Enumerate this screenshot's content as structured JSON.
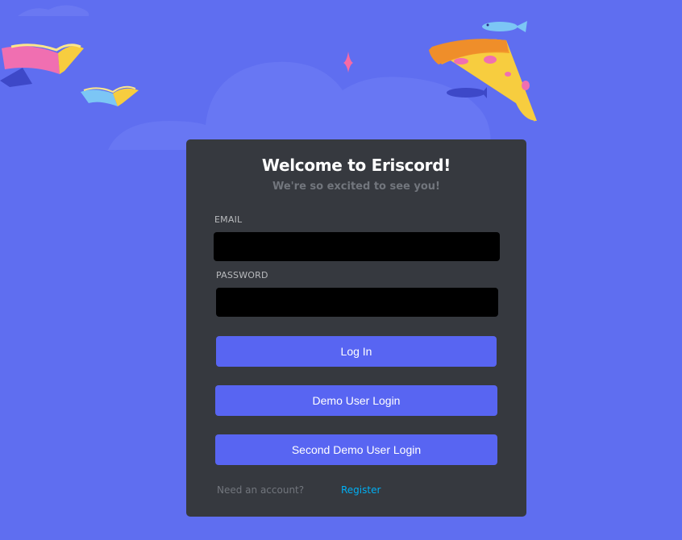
{
  "login": {
    "title": "Welcome to Eriscord!",
    "subtitle": "We're so excited to see you!",
    "email_label": "EMAIL",
    "email_value": "",
    "password_label": "PASSWORD",
    "password_value": "",
    "login_button": "Log In",
    "demo_button": "Demo User Login",
    "second_demo_button": "Second Demo User Login",
    "need_account": "Need an account?",
    "register_link": "Register"
  },
  "decorations": {
    "icons": [
      "cloud-icon",
      "book-icon",
      "sparkle-icon",
      "fish-icon",
      "pizza-icon"
    ]
  },
  "colors": {
    "background": "#5f6ef0",
    "card": "#36393f",
    "button": "#5865f2",
    "link": "#00aff4"
  }
}
